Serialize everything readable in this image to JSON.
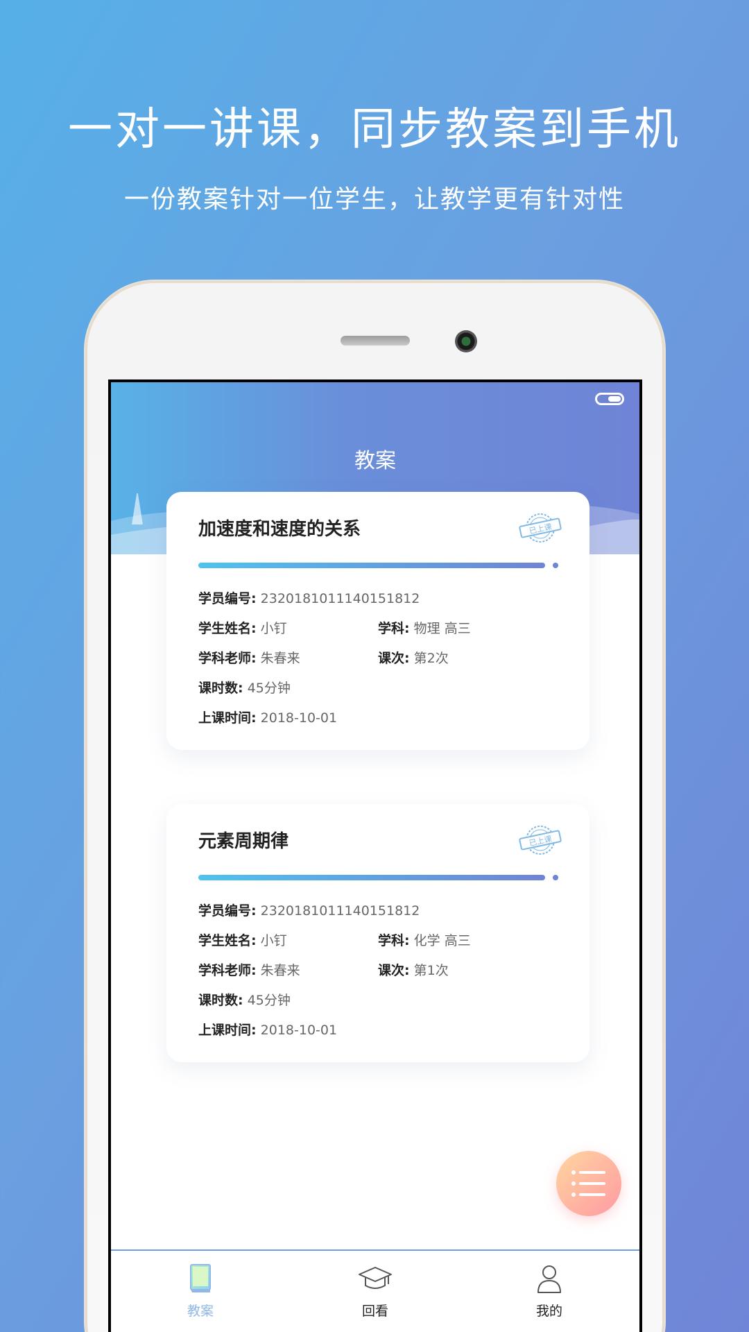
{
  "promo": {
    "title": "一对一讲课，同步教案到手机",
    "subtitle": "一份教案针对一位学生，让教学更有针对性"
  },
  "app": {
    "title": "教案"
  },
  "cards": [
    {
      "title": "加速度和速度的关系",
      "stamp": "已上课",
      "student_id_label": "学员编号:",
      "student_id": "2320181011140151812",
      "student_name_label": "学生姓名:",
      "student_name": "小钉",
      "subject_label": "学科:",
      "subject": "物理 高三",
      "teacher_label": "学科老师:",
      "teacher": "朱春来",
      "lesson_label": "课次:",
      "lesson": "第2次",
      "hours_label": "课时数:",
      "hours": "45分钟",
      "time_label": "上课时间:",
      "time": "2018-10-01"
    },
    {
      "title": "元素周期律",
      "stamp": "已上课",
      "student_id_label": "学员编号:",
      "student_id": "2320181011140151812",
      "student_name_label": "学生姓名:",
      "student_name": "小钉",
      "subject_label": "学科:",
      "subject": "化学 高三",
      "teacher_label": "学科老师:",
      "teacher": "朱春来",
      "lesson_label": "课次:",
      "lesson": "第1次",
      "hours_label": "课时数:",
      "hours": "45分钟",
      "time_label": "上课时间:",
      "time": "2018-10-01"
    }
  ],
  "tabs": [
    {
      "label": "教案",
      "icon": "book-icon",
      "active": true
    },
    {
      "label": "回看",
      "icon": "graduation-cap-icon",
      "active": false
    },
    {
      "label": "我的",
      "icon": "user-icon",
      "active": false
    }
  ],
  "fab_icon": "list-icon",
  "colors": {
    "accent": "#6f84d6",
    "accent_light": "#4fc2ee",
    "active_tab": "#8fb8e8",
    "fab_start": "#ffd6a0",
    "fab_end": "#ff9aa2"
  }
}
